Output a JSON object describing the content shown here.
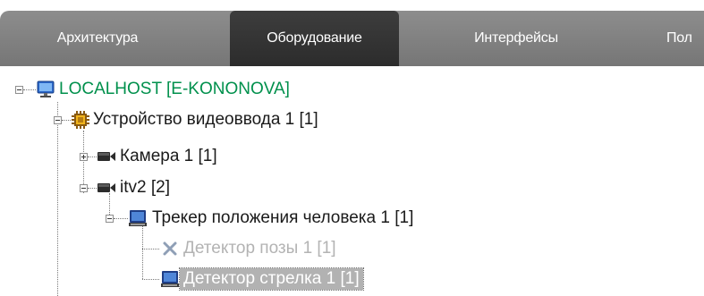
{
  "tabs": [
    {
      "label": "Архитектура",
      "active": false
    },
    {
      "label": "Оборудование",
      "active": true
    },
    {
      "label": "Интерфейсы",
      "active": false
    },
    {
      "label": "Пол",
      "active": false
    }
  ],
  "tree": {
    "root": {
      "label": "LOCALHOST [E-KONONOVA]",
      "expanded": true,
      "icon": "computer-icon"
    },
    "device": {
      "label": "Устройство видеоввода 1 [1]",
      "expanded": true,
      "icon": "chip-icon"
    },
    "camera1": {
      "label": "Камера 1 [1]",
      "expanded": false,
      "icon": "video-camera-icon"
    },
    "itv2": {
      "label": "itv2 [2]",
      "expanded": true,
      "icon": "video-camera-icon"
    },
    "tracker": {
      "label": "Трекер положения человека 1 [1]",
      "expanded": true,
      "icon": "monitor-icon"
    },
    "pose_detector": {
      "label": "Детектор позы 1 [1]",
      "disabled": true,
      "icon": "cross-icon"
    },
    "shooter_detector": {
      "label": "Детектор стрелка 1 [1]",
      "selected": true,
      "icon": "monitor-icon"
    }
  },
  "colors": {
    "root_label": "#00904c",
    "tab_bar": "#808080",
    "active_tab": "#333333",
    "selection": "#b2b2b2",
    "disabled_text": "#b3b3b3"
  }
}
